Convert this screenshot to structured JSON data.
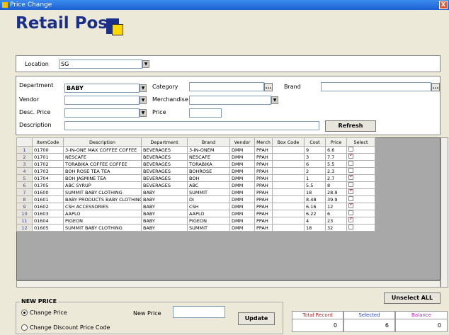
{
  "window": {
    "title": "Price Change",
    "close_glyph": "X"
  },
  "logo": {
    "text": "Retail Pos"
  },
  "location": {
    "label": "Location",
    "value": "SG"
  },
  "filters": {
    "department_label": "Department",
    "department_value": "BABY",
    "category_label": "Category",
    "category_value": "",
    "brand_label": "Brand",
    "brand_value": "",
    "vendor_label": "Vendor",
    "vendor_value": "",
    "merchandise_label": "Merchandise",
    "merchandise_value": "",
    "desc_price_label": "Desc. Price",
    "desc_price_value": "",
    "price_label": "Price",
    "price_value": "",
    "description_label": "Description",
    "description_value": "",
    "refresh_label": "Refresh"
  },
  "grid": {
    "columns": [
      "",
      "ItemCode",
      "Description",
      "Department",
      "Brand",
      "Vendor",
      "Merch",
      "Box Code",
      "Cost",
      "Price",
      "Select"
    ],
    "rows": [
      {
        "n": "1",
        "code": "01700",
        "desc": "3-IN-ONE MAX COFFEE COFFEE",
        "dept": "BEVERAGES",
        "brand": "3-IN-ONEM",
        "vendor": "DMM",
        "merch": "PPAH",
        "box": "",
        "cost": "9",
        "price": "6.6",
        "select": false
      },
      {
        "n": "2",
        "code": "01701",
        "desc": "NESCAFE",
        "dept": "BEVERAGES",
        "brand": "NESCAFE",
        "vendor": "DMM",
        "merch": "PPAH",
        "box": "",
        "cost": "3",
        "price": "7.7",
        "select": true
      },
      {
        "n": "3",
        "code": "01702",
        "desc": "TORABIKA COFFEE COFFEE",
        "dept": "BEVERAGES",
        "brand": "TORABIKA",
        "vendor": "DMM",
        "merch": "PPAH",
        "box": "",
        "cost": "6",
        "price": "5.5",
        "select": false
      },
      {
        "n": "4",
        "code": "01703",
        "desc": "BOH ROSE TEA TEA",
        "dept": "BEVERAGES",
        "brand": "BOHROSE",
        "vendor": "DMM",
        "merch": "PPAH",
        "box": "",
        "cost": "2",
        "price": "2.3",
        "select": false
      },
      {
        "n": "5",
        "code": "01704",
        "desc": "BOH JASMINE TEA",
        "dept": "BEVERAGES",
        "brand": "BOH",
        "vendor": "DMM",
        "merch": "PPAH",
        "box": "",
        "cost": "1",
        "price": "2.7",
        "select": true
      },
      {
        "n": "6",
        "code": "01705",
        "desc": "ABC SYRUP",
        "dept": "BEVERAGES",
        "brand": "ABC",
        "vendor": "DMM",
        "merch": "PPAH",
        "box": "",
        "cost": "5.5",
        "price": "8",
        "select": false
      },
      {
        "n": "7",
        "code": "01600",
        "desc": "SUMMIT BABY CLOTHING",
        "dept": "BABY",
        "brand": "SUMMIT",
        "vendor": "DMM",
        "merch": "PPAH",
        "box": "",
        "cost": "18",
        "price": "28.9",
        "select": true
      },
      {
        "n": "8",
        "code": "01601",
        "desc": "BABY PRODUCTS BABY CLOTHING DI",
        "dept": "BABY",
        "brand": "DI",
        "vendor": "DMM",
        "merch": "PPAH",
        "box": "",
        "cost": "8.48",
        "price": "39.9",
        "select": false
      },
      {
        "n": "9",
        "code": "01602",
        "desc": "CSH ACCESSORIES",
        "dept": "BABY",
        "brand": "CSH",
        "vendor": "DMM",
        "merch": "PPAH",
        "box": "",
        "cost": "6.16",
        "price": "12",
        "select": true
      },
      {
        "n": "10",
        "code": "01603",
        "desc": "AAPLO",
        "dept": "BABY",
        "brand": "AAPLO",
        "vendor": "DMM",
        "merch": "PPAH",
        "box": "",
        "cost": "6.22",
        "price": "6",
        "select": false
      },
      {
        "n": "11",
        "code": "01604",
        "desc": "PIGEON",
        "dept": "BABY",
        "brand": "PIGEON",
        "vendor": "DMM",
        "merch": "PPAH",
        "box": "",
        "cost": "4",
        "price": "23",
        "select": true
      },
      {
        "n": "12",
        "code": "01605",
        "desc": "SUMMIT BABY CLOTHING",
        "dept": "BABY",
        "brand": "SUMMIT",
        "vendor": "DMM",
        "merch": "PPAH",
        "box": "",
        "cost": "18",
        "price": "32",
        "select": false
      }
    ]
  },
  "unselect_all_label": "Unselect ALL",
  "new_price": {
    "group_label": "NEW PRICE",
    "opt_change_price": "Change Price",
    "opt_change_discount": "Change Discount Price Code",
    "new_price_label": "New Price",
    "new_price_value": "",
    "update_label": "Update"
  },
  "totals": {
    "total_label": "Total Record",
    "total_value": "0",
    "selected_label": "Selected",
    "selected_value": "6",
    "balance_label": "Balance",
    "balance_value": "0"
  }
}
